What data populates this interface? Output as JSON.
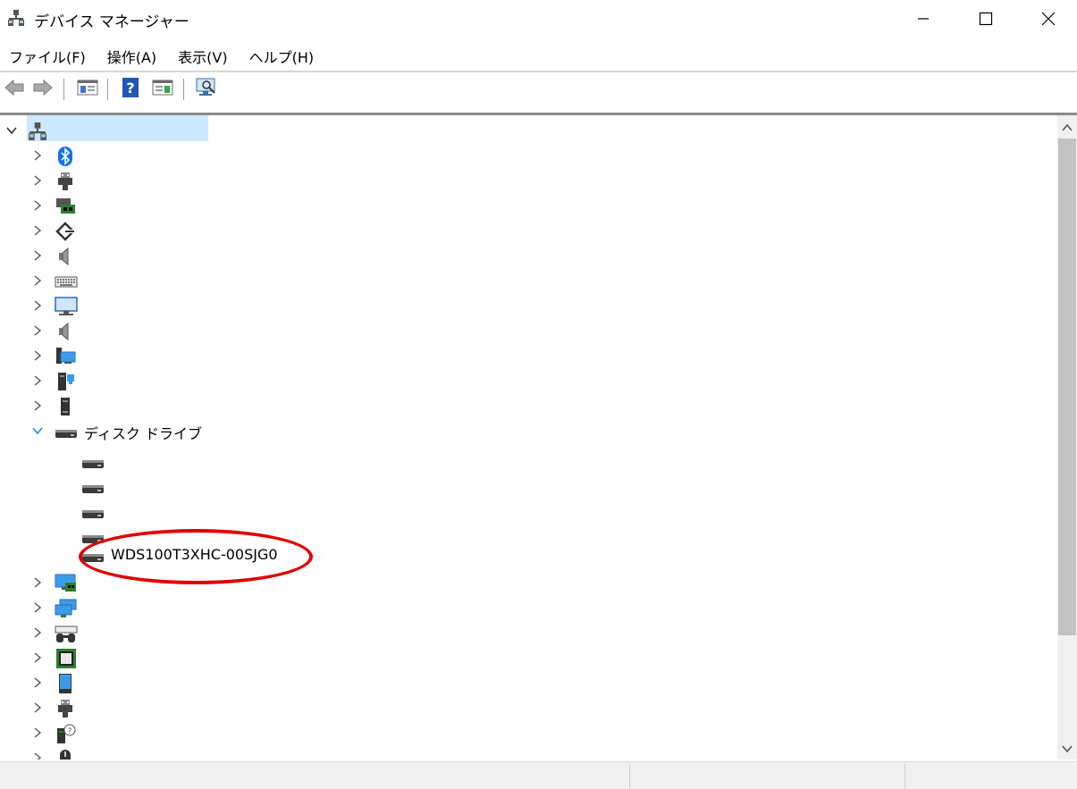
{
  "window": {
    "title": "デバイス マネージャー",
    "icon": "device-manager-icon"
  },
  "menu": [
    {
      "label": "ファイル(F)"
    },
    {
      "label": "操作(A)"
    },
    {
      "label": "表示(V)"
    },
    {
      "label": "ヘルプ(H)"
    }
  ],
  "toolbar": {
    "buttons": [
      "back-arrow-icon",
      "forward-arrow-icon",
      "properties-view-icon",
      "help-icon",
      "action-pane-icon",
      "scan-hardware-icon"
    ]
  },
  "tree": {
    "root": {
      "label": "",
      "icon": "computer-icon",
      "expanded": true
    },
    "categories": [
      {
        "icon": "bluetooth-icon",
        "label": ""
      },
      {
        "icon": "usb-connector-icon",
        "label": ""
      },
      {
        "icon": "monitor-card-icon",
        "label": ""
      },
      {
        "icon": "diamond-arrow-icon",
        "label": ""
      },
      {
        "icon": "speaker-icon",
        "label": ""
      },
      {
        "icon": "keyboard-icon",
        "label": ""
      },
      {
        "icon": "monitor-icon",
        "label": ""
      },
      {
        "icon": "speaker-icon",
        "label": ""
      },
      {
        "icon": "network-computer-icon",
        "label": ""
      },
      {
        "icon": "tower-puzzle-icon",
        "label": ""
      },
      {
        "icon": "tower-icon",
        "label": ""
      },
      {
        "icon": "disk-drive-icon",
        "label": "ディスク ドライブ",
        "expanded": true,
        "children": [
          {
            "icon": "disk-drive-icon",
            "label": ""
          },
          {
            "icon": "disk-drive-icon",
            "label": ""
          },
          {
            "icon": "disk-drive-icon",
            "label": ""
          },
          {
            "icon": "disk-drive-icon",
            "label": ""
          },
          {
            "icon": "disk-drive-icon",
            "label": "WDS100T3XHC-00SJG0"
          }
        ]
      },
      {
        "icon": "display-adapter-icon",
        "label": ""
      },
      {
        "icon": "network-adapter-icon",
        "label": ""
      },
      {
        "icon": "hid-icon",
        "label": ""
      },
      {
        "icon": "processor-icon",
        "label": ""
      },
      {
        "icon": "tablet-icon",
        "label": ""
      },
      {
        "icon": "usb-connector-icon",
        "label": ""
      },
      {
        "icon": "unknown-device-icon",
        "label": ""
      },
      {
        "icon": "mouse-icon",
        "label": ""
      }
    ]
  },
  "colors": {
    "selection": "#cce8ff",
    "annotation": "#e00000",
    "expand_active": "#1e90d6"
  }
}
